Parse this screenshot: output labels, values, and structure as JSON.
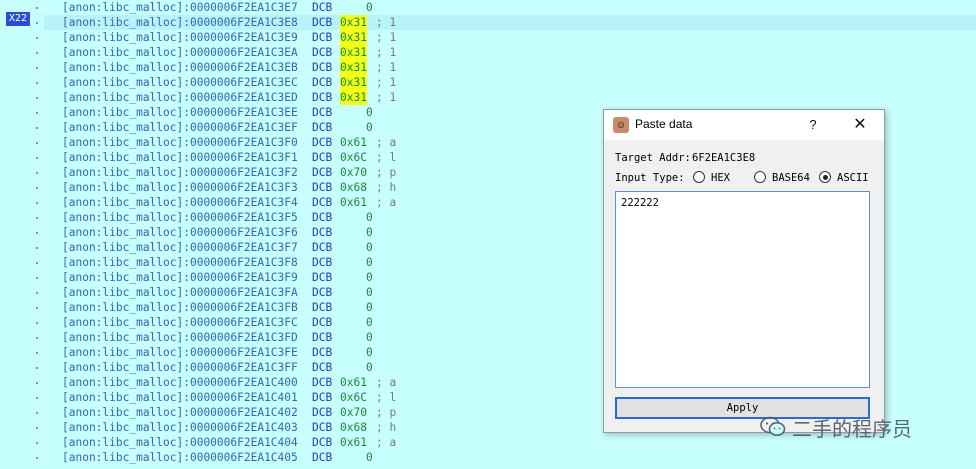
{
  "gutter": {
    "badge": "X22"
  },
  "listing": [
    {
      "addr": "[anon:libc_malloc]:0000006F2EA1C3E7",
      "kw": "DCB",
      "val": "0",
      "cmt": "",
      "hl": false,
      "mark": false
    },
    {
      "addr": "[anon:libc_malloc]:0000006F2EA1C3E8",
      "kw": "DCB",
      "val": "0x31",
      "cmt": "; 1",
      "hl": true,
      "mark": true
    },
    {
      "addr": "[anon:libc_malloc]:0000006F2EA1C3E9",
      "kw": "DCB",
      "val": "0x31",
      "cmt": "; 1",
      "hl": false,
      "mark": true
    },
    {
      "addr": "[anon:libc_malloc]:0000006F2EA1C3EA",
      "kw": "DCB",
      "val": "0x31",
      "cmt": "; 1",
      "hl": false,
      "mark": true
    },
    {
      "addr": "[anon:libc_malloc]:0000006F2EA1C3EB",
      "kw": "DCB",
      "val": "0x31",
      "cmt": "; 1",
      "hl": false,
      "mark": true
    },
    {
      "addr": "[anon:libc_malloc]:0000006F2EA1C3EC",
      "kw": "DCB",
      "val": "0x31",
      "cmt": "; 1",
      "hl": false,
      "mark": true
    },
    {
      "addr": "[anon:libc_malloc]:0000006F2EA1C3ED",
      "kw": "DCB",
      "val": "0x31",
      "cmt": "; 1",
      "hl": false,
      "mark": true
    },
    {
      "addr": "[anon:libc_malloc]:0000006F2EA1C3EE",
      "kw": "DCB",
      "val": "0",
      "cmt": "",
      "hl": false,
      "mark": false
    },
    {
      "addr": "[anon:libc_malloc]:0000006F2EA1C3EF",
      "kw": "DCB",
      "val": "0",
      "cmt": "",
      "hl": false,
      "mark": false
    },
    {
      "addr": "[anon:libc_malloc]:0000006F2EA1C3F0",
      "kw": "DCB",
      "val": "0x61",
      "cmt": "; a",
      "hl": false,
      "mark": false
    },
    {
      "addr": "[anon:libc_malloc]:0000006F2EA1C3F1",
      "kw": "DCB",
      "val": "0x6C",
      "cmt": "; l",
      "hl": false,
      "mark": false
    },
    {
      "addr": "[anon:libc_malloc]:0000006F2EA1C3F2",
      "kw": "DCB",
      "val": "0x70",
      "cmt": "; p",
      "hl": false,
      "mark": false
    },
    {
      "addr": "[anon:libc_malloc]:0000006F2EA1C3F3",
      "kw": "DCB",
      "val": "0x68",
      "cmt": "; h",
      "hl": false,
      "mark": false
    },
    {
      "addr": "[anon:libc_malloc]:0000006F2EA1C3F4",
      "kw": "DCB",
      "val": "0x61",
      "cmt": "; a",
      "hl": false,
      "mark": false
    },
    {
      "addr": "[anon:libc_malloc]:0000006F2EA1C3F5",
      "kw": "DCB",
      "val": "0",
      "cmt": "",
      "hl": false,
      "mark": false
    },
    {
      "addr": "[anon:libc_malloc]:0000006F2EA1C3F6",
      "kw": "DCB",
      "val": "0",
      "cmt": "",
      "hl": false,
      "mark": false
    },
    {
      "addr": "[anon:libc_malloc]:0000006F2EA1C3F7",
      "kw": "DCB",
      "val": "0",
      "cmt": "",
      "hl": false,
      "mark": false
    },
    {
      "addr": "[anon:libc_malloc]:0000006F2EA1C3F8",
      "kw": "DCB",
      "val": "0",
      "cmt": "",
      "hl": false,
      "mark": false
    },
    {
      "addr": "[anon:libc_malloc]:0000006F2EA1C3F9",
      "kw": "DCB",
      "val": "0",
      "cmt": "",
      "hl": false,
      "mark": false
    },
    {
      "addr": "[anon:libc_malloc]:0000006F2EA1C3FA",
      "kw": "DCB",
      "val": "0",
      "cmt": "",
      "hl": false,
      "mark": false
    },
    {
      "addr": "[anon:libc_malloc]:0000006F2EA1C3FB",
      "kw": "DCB",
      "val": "0",
      "cmt": "",
      "hl": false,
      "mark": false
    },
    {
      "addr": "[anon:libc_malloc]:0000006F2EA1C3FC",
      "kw": "DCB",
      "val": "0",
      "cmt": "",
      "hl": false,
      "mark": false
    },
    {
      "addr": "[anon:libc_malloc]:0000006F2EA1C3FD",
      "kw": "DCB",
      "val": "0",
      "cmt": "",
      "hl": false,
      "mark": false
    },
    {
      "addr": "[anon:libc_malloc]:0000006F2EA1C3FE",
      "kw": "DCB",
      "val": "0",
      "cmt": "",
      "hl": false,
      "mark": false
    },
    {
      "addr": "[anon:libc_malloc]:0000006F2EA1C3FF",
      "kw": "DCB",
      "val": "0",
      "cmt": "",
      "hl": false,
      "mark": false
    },
    {
      "addr": "[anon:libc_malloc]:0000006F2EA1C400",
      "kw": "DCB",
      "val": "0x61",
      "cmt": "; a",
      "hl": false,
      "mark": false
    },
    {
      "addr": "[anon:libc_malloc]:0000006F2EA1C401",
      "kw": "DCB",
      "val": "0x6C",
      "cmt": "; l",
      "hl": false,
      "mark": false
    },
    {
      "addr": "[anon:libc_malloc]:0000006F2EA1C402",
      "kw": "DCB",
      "val": "0x70",
      "cmt": "; p",
      "hl": false,
      "mark": false
    },
    {
      "addr": "[anon:libc_malloc]:0000006F2EA1C403",
      "kw": "DCB",
      "val": "0x68",
      "cmt": "; h",
      "hl": false,
      "mark": false
    },
    {
      "addr": "[anon:libc_malloc]:0000006F2EA1C404",
      "kw": "DCB",
      "val": "0x61",
      "cmt": "; a",
      "hl": false,
      "mark": false
    },
    {
      "addr": "[anon:libc_malloc]:0000006F2EA1C405",
      "kw": "DCB",
      "val": "0",
      "cmt": "",
      "hl": false,
      "mark": false
    }
  ],
  "dialog": {
    "title": "Paste data",
    "help_glyph": "?",
    "close_glyph": "✕",
    "app_icon": "paste-data-app-icon",
    "target_label": "Target Addr:",
    "target_value": "6F2EA1C3E8",
    "input_type_label": "Input Type:",
    "options": [
      {
        "label": "HEX",
        "selected": false
      },
      {
        "label": "BASE64",
        "selected": false
      },
      {
        "label": "ASCII",
        "selected": true
      }
    ],
    "text_value": "222222",
    "apply_label": "Apply"
  },
  "watermark": {
    "text": "二手的程序员",
    "icon": "wechat-icon"
  },
  "colors": {
    "background": "#c8ffff",
    "highlight_row": "#b7f3f8",
    "value_mark": "#f1ff1a",
    "address": "#2f67b9",
    "keyword": "#1e3fc0",
    "value": "#1a8a2f",
    "comment": "#7a7a7a",
    "badge": "#2a4fd6"
  }
}
